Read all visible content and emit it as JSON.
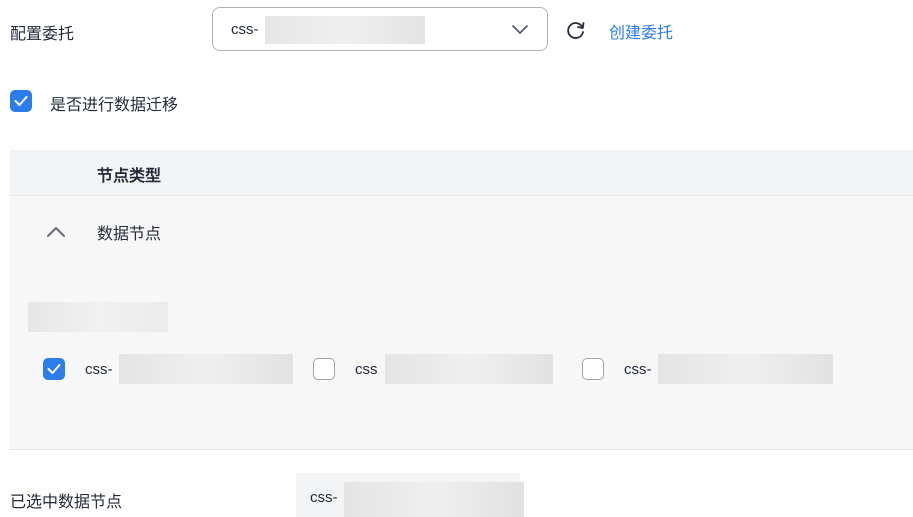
{
  "form": {
    "delegation_label": "配置委托",
    "delegation_value": "css-",
    "create_delegation_link": "创建委托",
    "migrate_label": "是否进行数据迁移",
    "migrate_checked": true
  },
  "table": {
    "header": "节点类型",
    "row_label": "数据节点",
    "row_expanded": true,
    "options": [
      {
        "label": "css-",
        "checked": true
      },
      {
        "label": "css",
        "checked": false
      },
      {
        "label": "css-",
        "checked": false
      }
    ]
  },
  "selected": {
    "label": "已选中数据节点",
    "value": "css-"
  },
  "colors": {
    "accent": "#2b7de9",
    "border": "#adb0b8",
    "header_bg": "#f3f4f6",
    "row_bg": "#f7f7f7"
  },
  "icons": [
    "chevron-down-icon",
    "refresh-icon",
    "check-icon",
    "chevron-up-icon"
  ]
}
